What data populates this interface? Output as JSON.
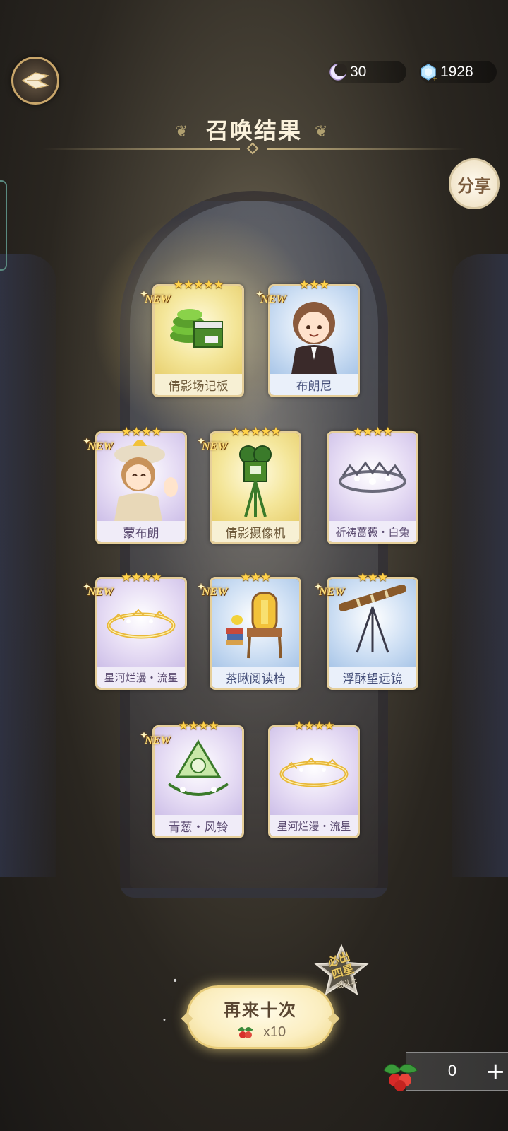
{
  "header": {
    "title": "召唤结果",
    "share_label": "分享"
  },
  "currency": {
    "moon": {
      "icon": "moon-icon",
      "value": "30"
    },
    "gem": {
      "icon": "crystal-gem-icon",
      "value": "1928"
    }
  },
  "cards": [
    {
      "name": "倩影场记板",
      "stars": 5,
      "new": true,
      "tone": "gold",
      "icon": "film-clapperboard-icon"
    },
    {
      "name": "布朗尼",
      "stars": 3,
      "new": true,
      "tone": "blue",
      "icon": "character-brownie-portrait"
    },
    {
      "name": "蒙布朗",
      "stars": 4,
      "new": true,
      "tone": "purple",
      "icon": "character-montblanc-portrait"
    },
    {
      "name": "倩影摄像机",
      "stars": 5,
      "new": true,
      "tone": "gold",
      "icon": "film-camera-icon"
    },
    {
      "name": "祈祷蔷薇・白兔",
      "stars": 4,
      "new": false,
      "tone": "purple",
      "icon": "tiara-icon"
    },
    {
      "name": "星河烂漫・流星",
      "stars": 4,
      "new": true,
      "tone": "purple",
      "icon": "crown-ring-icon"
    },
    {
      "name": "茶瞅阅读椅",
      "stars": 3,
      "new": true,
      "tone": "blue",
      "icon": "reading-chair-icon"
    },
    {
      "name": "浮酥望远镜",
      "stars": 3,
      "new": true,
      "tone": "blue",
      "icon": "telescope-icon"
    },
    {
      "name": "青葱・风铃",
      "stars": 4,
      "new": true,
      "tone": "purple",
      "icon": "wind-chime-headpiece-icon"
    },
    {
      "name": "星河烂漫・流星",
      "stars": 4,
      "new": false,
      "tone": "purple",
      "icon": "crown-ring-icon"
    }
  ],
  "new_label": "NEW",
  "retry": {
    "label": "再来十次",
    "cost": "x10",
    "cost_icon": "holly-berry-icon"
  },
  "guarantee_badge": {
    "line1": "必出",
    "line2": "四星",
    "line3": "或以上"
  },
  "counter": {
    "value": "0",
    "plus": "+",
    "icon": "holly-berry-icon"
  }
}
